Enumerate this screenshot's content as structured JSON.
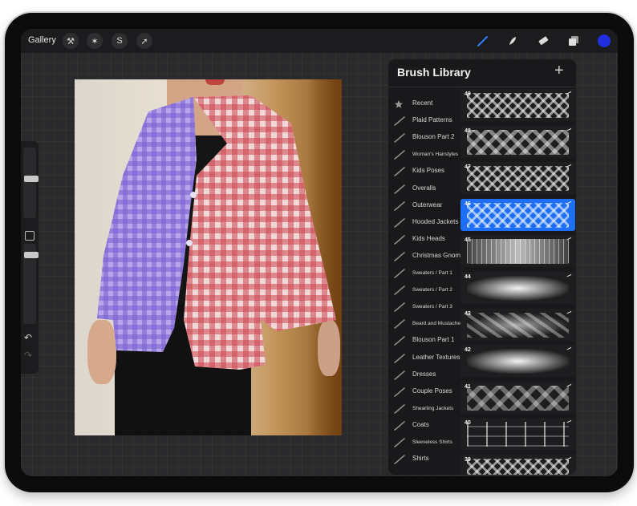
{
  "topbar": {
    "gallery_label": "Gallery",
    "left_tools": [
      {
        "name": "actions-wrench-icon",
        "glyph": "⚒"
      },
      {
        "name": "adjustments-wand-icon",
        "glyph": "✶"
      },
      {
        "name": "selection-icon",
        "glyph": "S"
      },
      {
        "name": "transform-arrow-icon",
        "glyph": "➚"
      }
    ],
    "right_tools": [
      "brush-icon",
      "smudge-icon",
      "eraser-icon",
      "layers-icon"
    ],
    "active_color": "#1f2fe0"
  },
  "sidebar": {
    "undo_glyph": "↶",
    "redo_glyph": "↷"
  },
  "brush_library": {
    "title": "Brush Library",
    "add_glyph": "+",
    "categories": [
      {
        "label": "Recent",
        "icon": "star"
      },
      {
        "label": "Plaid Patterns",
        "icon": "brush"
      },
      {
        "label": "Blouson Part 2",
        "icon": "brush"
      },
      {
        "label": "Woman's Hairstyles",
        "icon": "brush"
      },
      {
        "label": "Kids Poses",
        "icon": "brush"
      },
      {
        "label": "Overalls",
        "icon": "brush"
      },
      {
        "label": "Outerwear",
        "icon": "brush"
      },
      {
        "label": "Hooded Jackets",
        "icon": "brush"
      },
      {
        "label": "Kids Heads",
        "icon": "brush"
      },
      {
        "label": "Christmas Gnome",
        "icon": "brush"
      },
      {
        "label": "Sweaters / Part 1",
        "icon": "brush"
      },
      {
        "label": "Sweaters / Part 2",
        "icon": "brush"
      },
      {
        "label": "Sweaters / Part 3",
        "icon": "brush"
      },
      {
        "label": "Beard and Mustache",
        "icon": "brush"
      },
      {
        "label": "Blouson Part 1",
        "icon": "brush"
      },
      {
        "label": "Leather Textures",
        "icon": "brush"
      },
      {
        "label": "Dresses",
        "icon": "brush"
      },
      {
        "label": "Couple Poses",
        "icon": "brush"
      },
      {
        "label": "Shearling Jackets",
        "icon": "brush"
      },
      {
        "label": "Coats",
        "icon": "brush"
      },
      {
        "label": "Sleeveless Shirts",
        "icon": "brush"
      },
      {
        "label": "Shirts",
        "icon": "brush"
      }
    ],
    "brushes": [
      {
        "number": "49",
        "pattern": "p-diamond",
        "selected": false
      },
      {
        "number": "48",
        "pattern": "p-big",
        "selected": false
      },
      {
        "number": "47",
        "pattern": "p-diamond",
        "selected": false
      },
      {
        "number": "46",
        "pattern": "p-diamond",
        "selected": true
      },
      {
        "number": "45",
        "pattern": "p-plaid",
        "selected": false
      },
      {
        "number": "44",
        "pattern": "p-blend",
        "selected": false
      },
      {
        "number": "43",
        "pattern": "p-soft",
        "selected": false
      },
      {
        "number": "42",
        "pattern": "p-blend",
        "selected": false
      },
      {
        "number": "41",
        "pattern": "p-check",
        "selected": false
      },
      {
        "number": "40",
        "pattern": "p-vert",
        "selected": false
      },
      {
        "number": "39",
        "pattern": "p-diamond",
        "selected": false
      }
    ]
  }
}
